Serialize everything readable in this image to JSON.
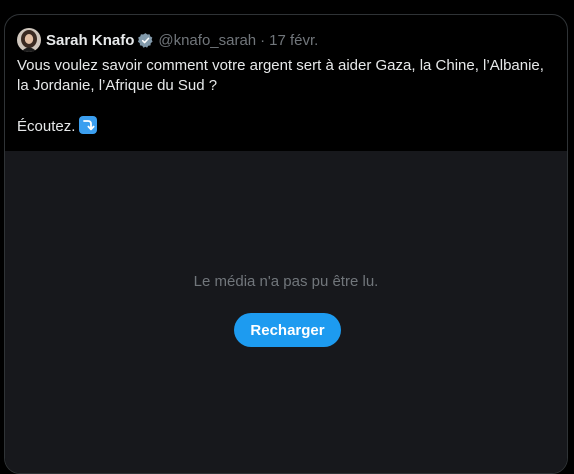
{
  "tweet": {
    "author_name": "Sarah Knafo",
    "handle": "@knafo_sarah",
    "separator": "·",
    "date": "17 févr.",
    "text_line1": "Vous voulez savoir comment votre argent sert à aider Gaza, la Chine, l’Albanie, la Jordanie, l’Afrique du Sud ?",
    "text_line2": "Écoutez.",
    "emoji": "arrow-curving-down-icon",
    "verified_icon": "verified-badge-icon"
  },
  "media": {
    "error_text": "Le média n'a pas pu être lu.",
    "reload_label": "Recharger"
  },
  "colors": {
    "background": "#000000",
    "media_background": "#17181c",
    "text_primary": "#e7e9ea",
    "text_secondary": "#71767b",
    "accent": "#1d9bf0",
    "border": "#2f3336"
  }
}
